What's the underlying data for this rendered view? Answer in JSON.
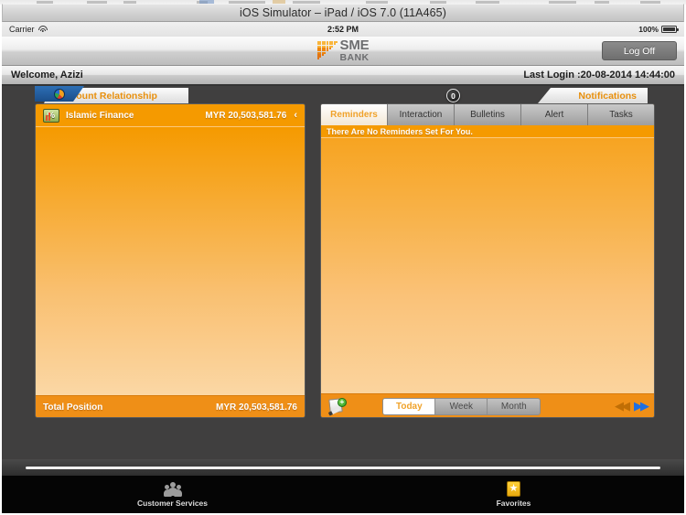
{
  "window": {
    "title": "iOS Simulator – iPad / iOS 7.0 (11A465)"
  },
  "statusbar": {
    "carrier": "Carrier",
    "wifi_icon": "wifi-icon",
    "time": "2:52 PM",
    "battery_percent": "100%",
    "battery_icon": "battery-full-icon"
  },
  "header": {
    "logo_sme": "SME",
    "logo_bank": "BANK",
    "logo_mark_color": "#F08000",
    "logoff_label": "Log Off"
  },
  "welcome": {
    "greeting": "Welcome, Azizi",
    "last_login": "Last Login :20-08-2014 14:44:00"
  },
  "left_panel": {
    "tab_label": "Account Relationship",
    "chart_icon": "pie-chart-icon",
    "account": {
      "icon": "percentage-icon",
      "name": "Islamic Finance",
      "amount": "MYR 20,503,581.76",
      "chevron": "‹"
    },
    "total": {
      "label": "Total Position",
      "amount": "MYR 20,503,581.76"
    }
  },
  "right_panel": {
    "tab_label": "Notifications",
    "badge_count": "0",
    "subtabs": [
      {
        "label": "Reminders",
        "active": true
      },
      {
        "label": "Interaction",
        "active": false
      },
      {
        "label": "Bulletins",
        "active": false
      },
      {
        "label": "Alert",
        "active": false
      },
      {
        "label": "Tasks",
        "active": false
      }
    ],
    "empty_message": "There Are No  Reminders Set For You.",
    "toolbar": {
      "add_note_icon": "add-note-icon",
      "segments": [
        {
          "label": "Today",
          "active": true
        },
        {
          "label": "Week",
          "active": false
        },
        {
          "label": "Month",
          "active": false
        }
      ],
      "prev_icon": "◀◀",
      "next_icon": "▶▶"
    }
  },
  "tabbar": {
    "items": [
      {
        "label": "Customer Services",
        "icon": "people-icon"
      },
      {
        "label": "Favorites",
        "icon": "star-icon"
      }
    ]
  },
  "colors": {
    "accent_orange": "#F59A00",
    "tab_text_orange": "#E8900E",
    "link_blue": "#1F6FE0",
    "content_bg": "#403F3F"
  }
}
